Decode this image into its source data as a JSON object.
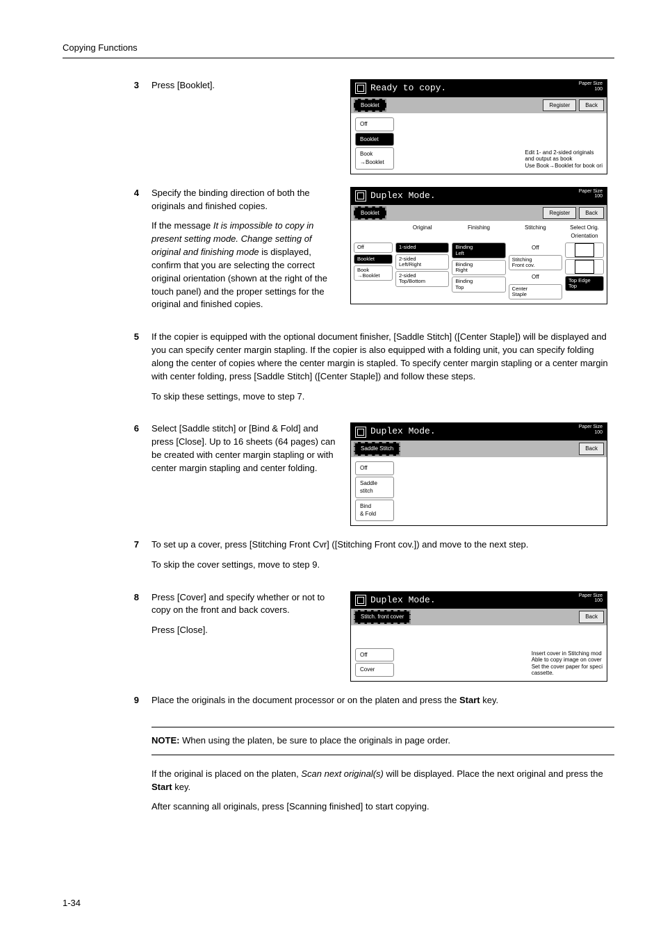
{
  "header": {
    "section_title": "Copying Functions"
  },
  "page_number": "1-34",
  "steps": {
    "s3": {
      "num": "3",
      "text": "Press [Booklet]."
    },
    "s4": {
      "num": "4",
      "p1": "Specify the binding direction of both the originals and finished copies.",
      "p2_prefix": "If the message ",
      "p2_italic": "It is impossible to copy in present setting mode. Change setting of original and finishing mode",
      "p2_suffix": " is displayed, confirm that you are selecting the correct original orientation (shown at the right of the touch panel) and the proper settings for the original and finished copies."
    },
    "s5": {
      "num": "5",
      "p1": "If the copier is equipped with the optional document finisher, [Saddle Stitch] ([Center Staple]) will be displayed and you can specify center margin stapling. If the copier is also equipped with a folding unit, you can specify folding along the center of copies where the center margin is stapled. To specify center margin stapling or a center margin with center folding, press [Saddle Stitch] ([Center Staple]) and follow these steps.",
      "p2": "To skip these settings, move to step 7."
    },
    "s6": {
      "num": "6",
      "text": "Select [Saddle stitch] or [Bind & Fold] and press [Close]. Up to 16 sheets (64 pages) can be created with center margin stapling or with center margin stapling and center folding."
    },
    "s7": {
      "num": "7",
      "p1": "To set up a cover, press [Stitching Front Cvr] ([Stitching Front cov.]) and move to the next step.",
      "p2": "To skip the cover settings, move to step 9."
    },
    "s8": {
      "num": "8",
      "p1": "Press [Cover] and specify whether or not to copy on the front and back covers.",
      "p2": "Press [Close]."
    },
    "s9": {
      "num": "9",
      "p1_prefix": "Place the originals in the document processor or on the platen and press the ",
      "p1_bold": "Start",
      "p1_suffix": " key."
    },
    "note": {
      "label": "NOTE:",
      "text": " When using the platen, be sure to place the originals in page order."
    },
    "tail": {
      "p1_prefix": "If the original is placed on the platen, ",
      "p1_italic": "Scan next original(s)",
      "p1_mid": " will be displayed. Place the next original and press the ",
      "p1_bold": "Start",
      "p1_suffix": " key.",
      "p2": "After scanning all originals, press [Scanning finished] to start copying."
    }
  },
  "screens": {
    "common": {
      "paper_size_label": "Paper Size",
      "paper_size_value": "100",
      "register": "Register",
      "back": "Back"
    },
    "screen1": {
      "title": "Ready to copy.",
      "crumb": "Booklet",
      "items": {
        "off": "Off",
        "booklet": "Booklet",
        "book_to_booklet": "Book\n→Booklet"
      },
      "hint": "Edit 1- and 2-sided originals\nand output as book\nUse Book→Booklet for book ori"
    },
    "screen2": {
      "title": "Duplex Mode.",
      "crumb": "Booklet",
      "headers": {
        "original": "Original",
        "finishing": "Finishing",
        "stitching": "Stitching",
        "orient": "Select Orig.\nOrientation"
      },
      "left": {
        "off": "Off",
        "booklet": "Booklet",
        "book_to_booklet": "Book\n→Booklet"
      },
      "col_original": {
        "a": "1-sided",
        "b": "2-sided\nLeft/Right",
        "c": "2-sided\nTop/Bottom"
      },
      "col_finishing": {
        "a": "Binding\nLeft",
        "b": "Binding\nRight",
        "c": "Binding\nTop"
      },
      "col_stitching": {
        "off": "Off",
        "a": "Stitching\nFront cov.",
        "b": "Off",
        "c": "Center\nStaple"
      },
      "orient": {
        "a": "",
        "b": "Top Edge\nTop"
      }
    },
    "screen3": {
      "title": "Duplex Mode.",
      "crumb": "Saddle Stitch",
      "items": {
        "off": "Off",
        "saddle": "Saddle\nstitch",
        "bindfold": "Bind\n& Fold"
      }
    },
    "screen4": {
      "title": "Duplex Mode.",
      "crumb": "Stitch. front cover",
      "items": {
        "off": "Off",
        "cover": "Cover"
      },
      "hint": "Insert cover in Stitching mod\nAble to copy image on cover\nSet the cover paper for speci\ncassette."
    }
  }
}
